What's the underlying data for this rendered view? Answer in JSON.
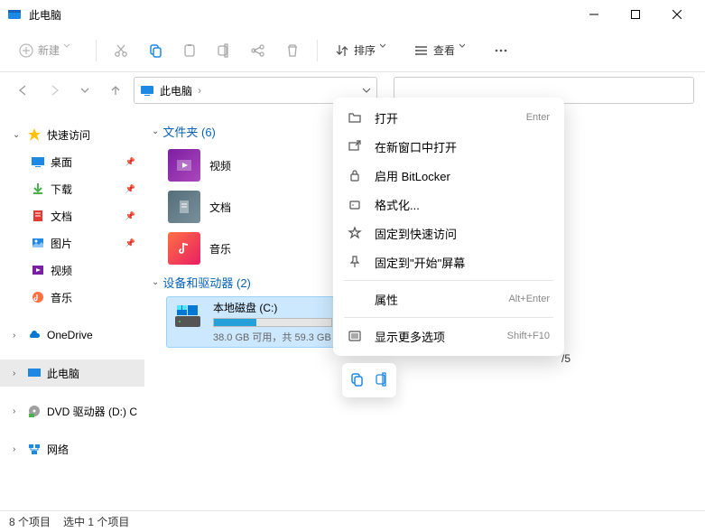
{
  "titlebar": {
    "title": "此电脑"
  },
  "toolbar": {
    "new_label": "新建",
    "sort_label": "排序",
    "view_label": "查看"
  },
  "address": {
    "location": "此电脑",
    "separator": "›"
  },
  "sidebar": {
    "quick_access": "快速访问",
    "desktop": "桌面",
    "downloads": "下载",
    "documents": "文档",
    "pictures": "图片",
    "videos": "视频",
    "music": "音乐",
    "onedrive": "OneDrive",
    "this_pc": "此电脑",
    "dvd": "DVD 驱动器 (D:) CP",
    "network": "网络"
  },
  "sections": {
    "folders_label": "文件夹 (6)",
    "devices_label": "设备和驱动器 (2)"
  },
  "folders": {
    "videos": "视频",
    "documents": "文档",
    "music": "音乐"
  },
  "drive": {
    "name": "本地磁盘 (C:)",
    "subtitle": "38.0 GB 可用，共 59.3 GB",
    "fill_percent": 36
  },
  "peek": "/5",
  "context_menu": {
    "open": "打开",
    "open_key": "Enter",
    "new_window": "在新窗口中打开",
    "bitlocker": "启用 BitLocker",
    "format": "格式化...",
    "pin_quick": "固定到快速访问",
    "pin_start": "固定到\"开始\"屏幕",
    "properties": "属性",
    "properties_key": "Alt+Enter",
    "more": "显示更多选项",
    "more_key": "Shift+F10"
  },
  "statusbar": {
    "count": "8 个项目",
    "selection": "选中 1 个项目"
  }
}
